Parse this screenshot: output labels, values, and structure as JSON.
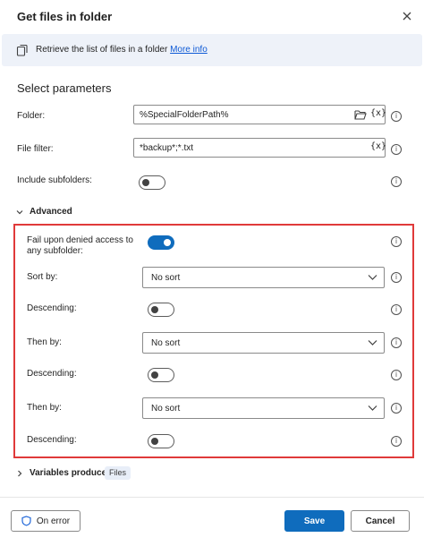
{
  "dialog": {
    "title": "Get files in folder"
  },
  "info": {
    "text": "Retrieve the list of files in a folder",
    "link": "More info"
  },
  "section_title": "Select parameters",
  "fields": {
    "folder": {
      "label": "Folder:",
      "value": "%SpecialFolderPath%",
      "var_button": "{x}"
    },
    "file_filter": {
      "label": "File filter:",
      "value": "*backup*;*.txt",
      "var_button": "{x}"
    },
    "include_subfolders": {
      "label": "Include subfolders:",
      "checked": false
    }
  },
  "advanced": {
    "label": "Advanced",
    "expanded": true,
    "fail_denied": {
      "label": "Fail upon denied access to any subfolder:",
      "checked": true
    },
    "sort_by": {
      "label": "Sort by:",
      "value": "No sort"
    },
    "descending1": {
      "label": "Descending:",
      "checked": false
    },
    "then_by1": {
      "label": "Then by:",
      "value": "No sort"
    },
    "descending2": {
      "label": "Descending:",
      "checked": false
    },
    "then_by2": {
      "label": "Then by:",
      "value": "No sort"
    },
    "descending3": {
      "label": "Descending:",
      "checked": false
    }
  },
  "variables": {
    "label": "Variables produced",
    "badge": "Files"
  },
  "footer": {
    "on_error": "On error",
    "save": "Save",
    "cancel": "Cancel"
  },
  "help_glyph": "i",
  "colors": {
    "accent": "#0f6cbd",
    "highlight_border": "#e03a3a",
    "info_bg": "#eef2f9"
  }
}
